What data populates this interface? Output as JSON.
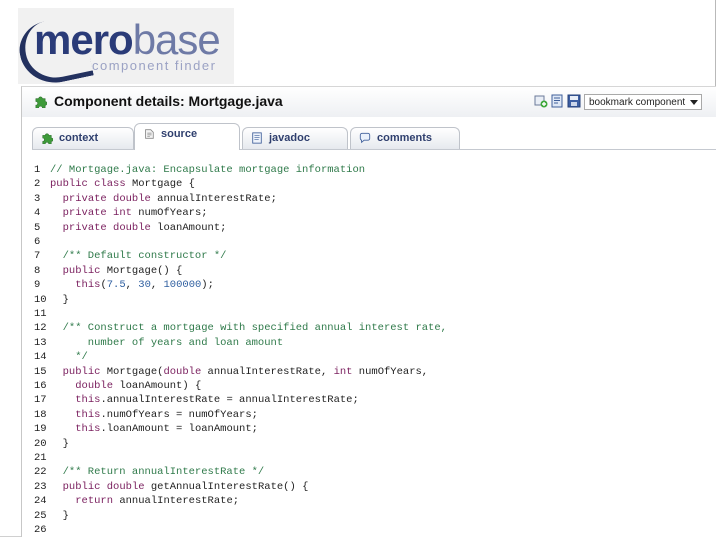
{
  "logo": {
    "brand_primary": "mero",
    "brand_secondary": "base",
    "tagline": "component finder",
    "colors": {
      "primary": "#2a3b78",
      "secondary": "#6e7aa6",
      "tagline": "#9ba2c4"
    }
  },
  "header": {
    "title": "Component details: Mortgage.java",
    "title_icon": "puzzle-icon",
    "action_icons": [
      "add-bookmark-icon",
      "note-icon",
      "save-icon"
    ],
    "bookmark_select": {
      "selected": "bookmark component"
    }
  },
  "tabs": [
    {
      "label": "context",
      "icon": "puzzle-icon",
      "active": false
    },
    {
      "label": "source",
      "icon": "source-icon",
      "active": true
    },
    {
      "label": "javadoc",
      "icon": "document-icon",
      "active": false
    },
    {
      "label": "comments",
      "icon": "speech-bubble-icon",
      "active": false
    }
  ],
  "source": {
    "lines": [
      {
        "n": "1",
        "text": "// Mortgage.java: Encapsulate mortgage information"
      },
      {
        "n": "2",
        "text": "public class Mortgage {"
      },
      {
        "n": "3",
        "text": "  private double annualInterestRate;"
      },
      {
        "n": "4",
        "text": "  private int numOfYears;"
      },
      {
        "n": "5",
        "text": "  private double loanAmount;"
      },
      {
        "n": "6",
        "text": ""
      },
      {
        "n": "7",
        "text": "  /** Default constructor */"
      },
      {
        "n": "8",
        "text": "  public Mortgage() {"
      },
      {
        "n": "9",
        "text": "    this(7.5, 30, 100000);"
      },
      {
        "n": "10",
        "text": "  }"
      },
      {
        "n": "11",
        "text": ""
      },
      {
        "n": "12",
        "text": "  /** Construct a mortgage with specified annual interest rate,"
      },
      {
        "n": "13",
        "text": "      number of years and loan amount"
      },
      {
        "n": "14",
        "text": "    */"
      },
      {
        "n": "15",
        "text": "  public Mortgage(double annualInterestRate, int numOfYears,"
      },
      {
        "n": "16",
        "text": "    double loanAmount) {"
      },
      {
        "n": "17",
        "text": "    this.annualInterestRate = annualInterestRate;"
      },
      {
        "n": "18",
        "text": "    this.numOfYears = numOfYears;"
      },
      {
        "n": "19",
        "text": "    this.loanAmount = loanAmount;"
      },
      {
        "n": "20",
        "text": "  }"
      },
      {
        "n": "21",
        "text": ""
      },
      {
        "n": "22",
        "text": "  /** Return annualInterestRate */"
      },
      {
        "n": "23",
        "text": "  public double getAnnualInterestRate() {"
      },
      {
        "n": "24",
        "text": "    return annualInterestRate;"
      },
      {
        "n": "25",
        "text": "  }"
      },
      {
        "n": "26",
        "text": ""
      }
    ],
    "colors": {
      "keyword": "#7a1f5e",
      "comment": "#2f7a4a",
      "number": "#2f5fa0",
      "text": "#222222"
    }
  }
}
